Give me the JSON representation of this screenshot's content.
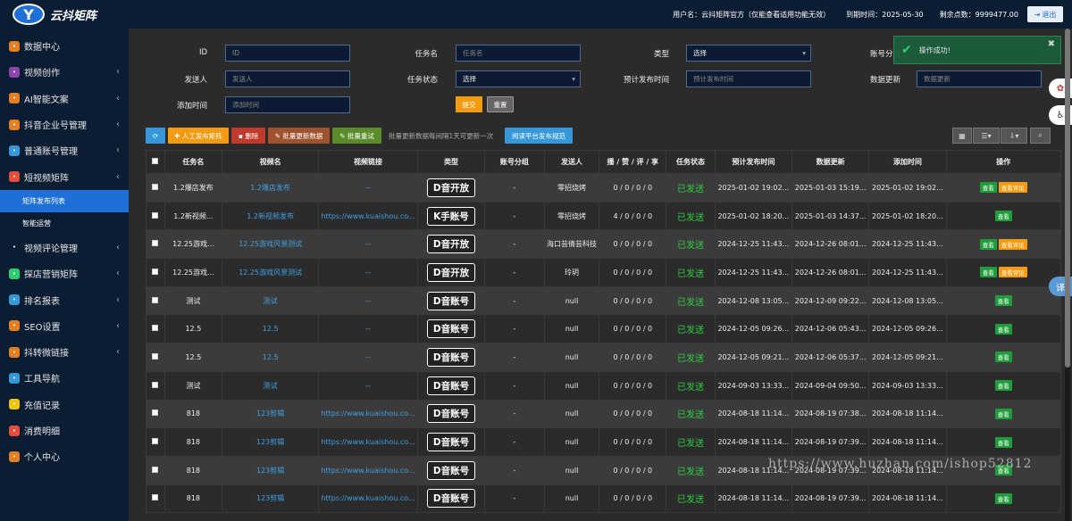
{
  "brand": {
    "logo_letter": "Y",
    "title": "云抖矩阵"
  },
  "header": {
    "username_label": "用户名：云抖矩阵官方（仅能查看适用功能无效）",
    "expire_label": "到期时间：2025-05-30",
    "points_label": "剩余点数：9999477.00",
    "logout_label": "退出"
  },
  "sidebar": {
    "items": [
      {
        "label": "数据中心",
        "icon": "dashboard-icon",
        "color": "#e67e22",
        "arrow": false
      },
      {
        "label": "视频创作",
        "icon": "video-icon",
        "color": "#8e44ad",
        "arrow": true
      },
      {
        "label": "AI智能文案",
        "icon": "ai-icon",
        "color": "#e67e22",
        "arrow": true
      },
      {
        "label": "抖音企业号管理",
        "icon": "enterprise-icon",
        "color": "#e67e22",
        "arrow": true
      },
      {
        "label": "普通账号管理",
        "icon": "account-icon",
        "color": "#3498db",
        "arrow": true
      },
      {
        "label": "短视频矩阵",
        "icon": "matrix-icon",
        "color": "#e74c3c",
        "arrow": true
      }
    ],
    "sub_items": [
      {
        "label": "矩阵发布列表",
        "active": true
      },
      {
        "label": "智能运营",
        "active": false
      }
    ],
    "items2": [
      {
        "label": "视频评论管理",
        "icon": "comment-icon",
        "color": "#0b1d33",
        "arrow": true
      },
      {
        "label": "探店营销矩阵",
        "icon": "store-icon",
        "color": "#2ecc71",
        "arrow": true
      },
      {
        "label": "排名报表",
        "icon": "report-icon",
        "color": "#3498db",
        "arrow": true
      },
      {
        "label": "SEO设置",
        "icon": "seo-icon",
        "color": "#e67e22",
        "arrow": true
      },
      {
        "label": "抖转微链接",
        "icon": "link-icon",
        "color": "#e67e22",
        "arrow": true
      },
      {
        "label": "工具导航",
        "icon": "tool-icon",
        "color": "#3498db",
        "arrow": false
      },
      {
        "label": "充值记录",
        "icon": "recharge-icon",
        "color": "#f1c40f",
        "arrow": false
      },
      {
        "label": "消费明细",
        "icon": "consume-icon",
        "color": "#e74c3c",
        "arrow": false
      },
      {
        "label": "个人中心",
        "icon": "user-icon",
        "color": "#e67e22",
        "arrow": false
      }
    ]
  },
  "filters": {
    "id": {
      "label": "ID",
      "placeholder": "ID"
    },
    "task_name": {
      "label": "任务名",
      "placeholder": "任务名"
    },
    "type": {
      "label": "类型",
      "value": "选择"
    },
    "account_group": {
      "label": "账号分组"
    },
    "sender": {
      "label": "发送人",
      "placeholder": "发送人"
    },
    "task_status": {
      "label": "任务状态",
      "value": "选择"
    },
    "plan_time": {
      "label": "预计发布时间",
      "placeholder": "预计发布时间"
    },
    "data_update": {
      "label": "数据更新",
      "placeholder": "数据更新"
    },
    "add_time": {
      "label": "添加时间",
      "placeholder": "添加时间"
    },
    "submit_label": "提交",
    "reset_label": "重置"
  },
  "toolbar": {
    "refresh_icon": "refresh-icon",
    "manual_publish": "人工发布矩阵",
    "delete": "删除",
    "batch_update": "批量更新数据",
    "batch_retry": "批量重试",
    "note": "批量更新数据每间隔1天可更新一次",
    "read_rules": "阅读平台发布规范"
  },
  "toast": {
    "message": "操作成功!"
  },
  "table": {
    "headers": [
      "",
      "任务名",
      "视频名",
      "视频链接",
      "类型",
      "账号分组",
      "发送人",
      "播 / 赞 / 评 / 享",
      "任务状态",
      "预计发布时间",
      "数据更新",
      "添加时间",
      "操作"
    ],
    "rows": [
      {
        "task": "1.2爆店发布",
        "video": "1.2爆店发布",
        "link": "--",
        "type": "D音开放",
        "group": "-",
        "sender": "零招烧烤",
        "stats": "0 / 0 / 0 / 0",
        "status": "已发送",
        "plan": "2025-01-02 19:02...",
        "update": "2025-01-03 15:19...",
        "added": "2025-01-02 19:02...",
        "ops": [
          "查看",
          "查看评论"
        ]
      },
      {
        "task": "1.2新视频...",
        "video": "1.2新视频发布",
        "link": "https://www.kuaishou.co...",
        "type": "K手账号",
        "group": "-",
        "sender": "零招烧烤",
        "stats": "4 / 0 / 0 / 0",
        "status": "已发送",
        "plan": "2025-01-02 18:20...",
        "update": "2025-01-03 14:37...",
        "added": "2025-01-02 18:20...",
        "ops": [
          "查看"
        ]
      },
      {
        "task": "12.25游戏...",
        "video": "12.25游戏风景测试",
        "link": "--",
        "type": "D音开放",
        "group": "-",
        "sender": "海口芸倩芸科技",
        "stats": "0 / 0 / 0 / 0",
        "status": "已发送",
        "plan": "2024-12-25 11:43...",
        "update": "2024-12-26 08:01...",
        "added": "2024-12-25 11:43...",
        "ops": [
          "查看",
          "查看评论"
        ]
      },
      {
        "task": "12.25游戏...",
        "video": "12.25游戏风景测试",
        "link": "--",
        "type": "D音开放",
        "group": "-",
        "sender": "玲玥",
        "stats": "0 / 0 / 0 / 0",
        "status": "已发送",
        "plan": "2024-12-25 11:43...",
        "update": "2024-12-26 08:01...",
        "added": "2024-12-25 11:43...",
        "ops": [
          "查看",
          "查看评论"
        ]
      },
      {
        "task": "测试",
        "video": "测试",
        "link": "--",
        "type": "D音账号",
        "group": "-",
        "sender": "null",
        "stats": "0 / 0 / 0 / 0",
        "status": "已发送",
        "plan": "2024-12-08 13:05...",
        "update": "2024-12-09 09:22...",
        "added": "2024-12-08 13:05...",
        "ops": [
          "查看"
        ]
      },
      {
        "task": "12.5",
        "video": "12.5",
        "link": "--",
        "type": "D音账号",
        "group": "-",
        "sender": "null",
        "stats": "0 / 0 / 0 / 0",
        "status": "已发送",
        "plan": "2024-12-05 09:26...",
        "update": "2024-12-06 05:43...",
        "added": "2024-12-05 09:26...",
        "ops": [
          "查看"
        ]
      },
      {
        "task": "12.5",
        "video": "12.5",
        "link": "--",
        "type": "D音账号",
        "group": "-",
        "sender": "null",
        "stats": "0 / 0 / 0 / 0",
        "status": "已发送",
        "plan": "2024-12-05 09:21...",
        "update": "2024-12-06 05:37...",
        "added": "2024-12-05 09:21...",
        "ops": [
          "查看"
        ]
      },
      {
        "task": "测试",
        "video": "测试",
        "link": "--",
        "type": "D音账号",
        "group": "-",
        "sender": "null",
        "stats": "0 / 0 / 0 / 0",
        "status": "已发送",
        "plan": "2024-09-03 13:33...",
        "update": "2024-09-04 09:50...",
        "added": "2024-09-03 13:33...",
        "ops": [
          "查看"
        ]
      },
      {
        "task": "818",
        "video": "123剪辑",
        "link": "https://www.kuaishou.co...",
        "type": "D音账号",
        "group": "-",
        "sender": "null",
        "stats": "0 / 0 / 0 / 0",
        "status": "已发送",
        "plan": "2024-08-18 11:14...",
        "update": "2024-08-19 07:38...",
        "added": "2024-08-18 11:14...",
        "ops": [
          "查看"
        ]
      },
      {
        "task": "818",
        "video": "123剪辑",
        "link": "https://www.kuaishou.co...",
        "type": "D音账号",
        "group": "-",
        "sender": "null",
        "stats": "0 / 0 / 0 / 0",
        "status": "已发送",
        "plan": "2024-08-18 11:14...",
        "update": "2024-08-19 07:39...",
        "added": "2024-08-18 11:14...",
        "ops": [
          "查看"
        ]
      },
      {
        "task": "818",
        "video": "123剪辑",
        "link": "https://www.kuaishou.co...",
        "type": "D音账号",
        "group": "-",
        "sender": "null",
        "stats": "0 / 0 / 0 / 0",
        "status": "已发送",
        "plan": "2024-08-18 11:14...",
        "update": "2024-08-19 07:39...",
        "added": "2024-08-18 11:14...",
        "ops": [
          "查看"
        ]
      },
      {
        "task": "818",
        "video": "123剪辑",
        "link": "https://www.kuaishou.co...",
        "type": "D音账号",
        "group": "-",
        "sender": "null",
        "stats": "0 / 0 / 0 / 0",
        "status": "已发送",
        "plan": "2024-08-18 11:14...",
        "update": "2024-08-19 07:39...",
        "added": "2024-08-18 11:14...",
        "ops": [
          "查看"
        ]
      }
    ]
  },
  "float_buttons": {
    "translate_label": "译"
  },
  "watermark": "https://www.huzhan.com/ishop52812"
}
